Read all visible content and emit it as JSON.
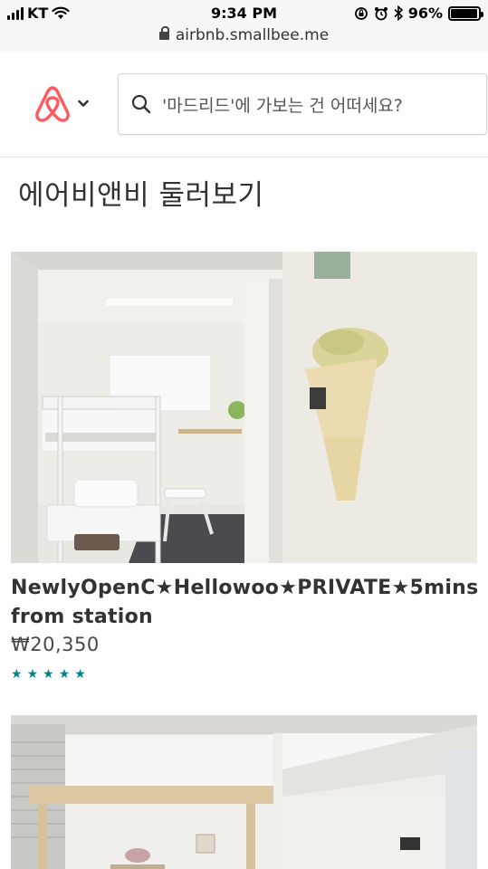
{
  "status_bar": {
    "carrier": "KT",
    "time": "9:34 PM",
    "battery": "96%",
    "battery_level": 0.96
  },
  "browser": {
    "url": "airbnb.smallbee.me"
  },
  "header": {
    "logo": "airbnb-logo",
    "search_placeholder": "'마드리드'에 가보는 건 어떠세요?"
  },
  "main": {
    "section_title": "에어비앤비 둘러보기",
    "listings": [
      {
        "title": "NewlyOpenC★Hellowoo★PRIVATE★5mins from station",
        "price": "₩20,350",
        "rating_stars": 5
      },
      {}
    ]
  },
  "colors": {
    "brand": "#FF5A5F",
    "star": "#008489"
  }
}
